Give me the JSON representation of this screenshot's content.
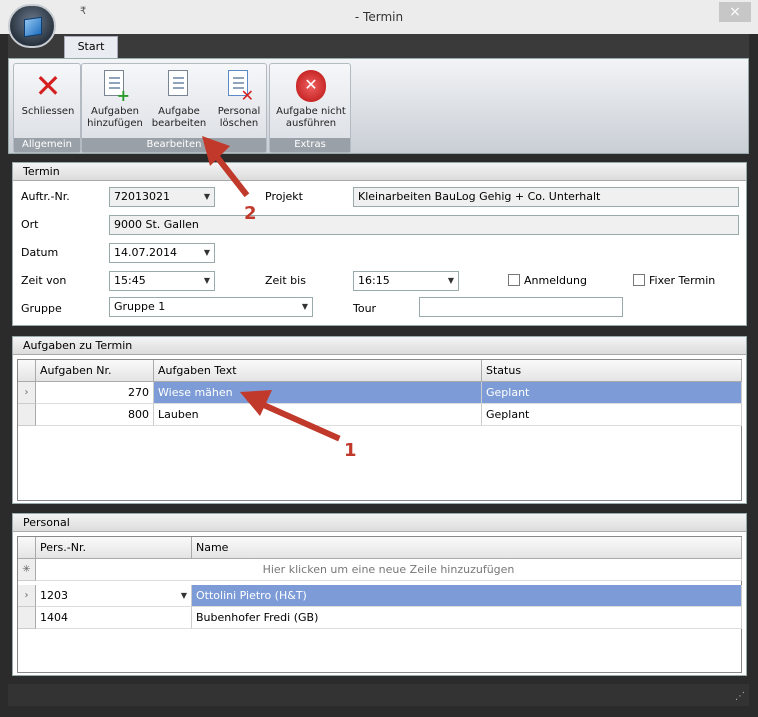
{
  "window": {
    "title": "- Termin",
    "close_glyph": "×"
  },
  "qat_glyph": "₹",
  "ribbon": {
    "tab": "Start",
    "groups": [
      {
        "label": "Allgemein",
        "buttons": [
          {
            "label": "Schliessen",
            "icon": "close-x-icon"
          }
        ]
      },
      {
        "label": "Bearbeiten",
        "buttons": [
          {
            "label": "Aufgaben hinzufügen",
            "line1": "Aufgaben",
            "line2": "hinzufügen",
            "icon": "add-task-icon"
          },
          {
            "label": "Aufgabe bearbeiten",
            "line1": "Aufgabe",
            "line2": "bearbeiten",
            "icon": "edit-task-icon"
          },
          {
            "label": "Personal löschen",
            "line1": "Personal",
            "line2": "löschen",
            "icon": "delete-personnel-icon"
          }
        ]
      },
      {
        "label": "Extras",
        "buttons": [
          {
            "label": "Aufgabe nicht ausführen",
            "line1": "Aufgabe nicht",
            "line2": "ausführen",
            "icon": "cancel-task-icon"
          }
        ]
      }
    ]
  },
  "termin": {
    "header": "Termin",
    "auftr_label": "Auftr.-Nr.",
    "auftr_value": "72013021",
    "projekt_label": "Projekt",
    "projekt_value": "Kleinarbeiten BauLog Gehig + Co. Unterhalt",
    "ort_label": "Ort",
    "ort_value": "9000 St. Gallen",
    "datum_label": "Datum",
    "datum_value": "14.07.2014",
    "zeitvon_label": "Zeit von",
    "zeitvon_value": "15:45",
    "zeitbis_label": "Zeit bis",
    "zeitbis_value": "16:15",
    "anmeldung_label": "Anmeldung",
    "anmeldung_checked": false,
    "fixer_label": "Fixer Termin",
    "fixer_checked": false,
    "gruppe_label": "Gruppe",
    "gruppe_value": "Gruppe 1",
    "tour_label": "Tour",
    "tour_value": ""
  },
  "aufgaben": {
    "header": "Aufgaben zu Termin",
    "columns": [
      "Aufgaben Nr.",
      "Aufgaben Text",
      "Status"
    ],
    "rows": [
      {
        "nr": "270",
        "text": "Wiese mähen",
        "status": "Geplant",
        "selected": true
      },
      {
        "nr": "800",
        "text": "Lauben",
        "status": "Geplant",
        "selected": false
      }
    ]
  },
  "personal": {
    "header": "Personal",
    "columns": [
      "Pers.-Nr.",
      "Name"
    ],
    "new_row_hint": "Hier klicken um eine neue Zeile hinzuzufügen",
    "rows": [
      {
        "nr": "1203",
        "name": "Ottolini Pietro (H&T)",
        "selected": true
      },
      {
        "nr": "1404",
        "name": "Bubenhofer Fredi (GB)",
        "selected": false
      }
    ]
  },
  "annotations": [
    {
      "label": "1"
    },
    {
      "label": "2"
    }
  ],
  "colors": {
    "selection": "#7d9bd6",
    "annotation": "#c0392b"
  }
}
